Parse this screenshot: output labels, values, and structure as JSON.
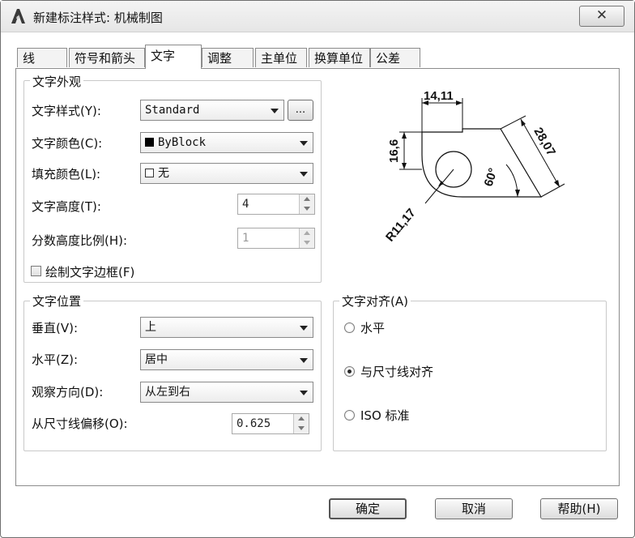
{
  "window": {
    "title": "新建标注样式: 机械制图",
    "close_glyph": "✕"
  },
  "tabs": [
    {
      "label": "线"
    },
    {
      "label": "符号和箭头"
    },
    {
      "label": "文字"
    },
    {
      "label": "调整"
    },
    {
      "label": "主单位"
    },
    {
      "label": "换算单位"
    },
    {
      "label": "公差"
    }
  ],
  "text_appearance": {
    "group_label": "文字外观",
    "style_label": "文字样式(Y):",
    "style_value": "Standard",
    "style_button": "...",
    "color_label": "文字颜色(C):",
    "color_value": "ByBlock",
    "fill_label": "填充颜色(L):",
    "fill_value": "无",
    "height_label": "文字高度(T):",
    "height_value": "4",
    "fraction_label": "分数高度比例(H):",
    "fraction_value": "1",
    "frame_label": "绘制文字边框(F)"
  },
  "text_placement": {
    "group_label": "文字位置",
    "vertical_label": "垂直(V):",
    "vertical_value": "上",
    "horizontal_label": "水平(Z):",
    "horizontal_value": "居中",
    "view_label": "观察方向(D):",
    "view_value": "从左到右",
    "offset_label": "从尺寸线偏移(O):",
    "offset_value": "0.625"
  },
  "text_alignment": {
    "group_label": "文字对齐(A)",
    "options": [
      {
        "label": "水平",
        "selected": false
      },
      {
        "label": "与尺寸线对齐",
        "selected": true
      },
      {
        "label": "ISO 标准",
        "selected": false
      }
    ]
  },
  "preview": {
    "dim_top": "14,11",
    "dim_left": "16,6",
    "dim_right": "28,07",
    "dim_angle": "60°",
    "dim_radius": "R11,17"
  },
  "buttons": {
    "ok": "确定",
    "cancel": "取消",
    "help": "帮助(H)"
  },
  "colors": {
    "color_swatch": "#000000",
    "fill_swatch": "#ffffff"
  }
}
